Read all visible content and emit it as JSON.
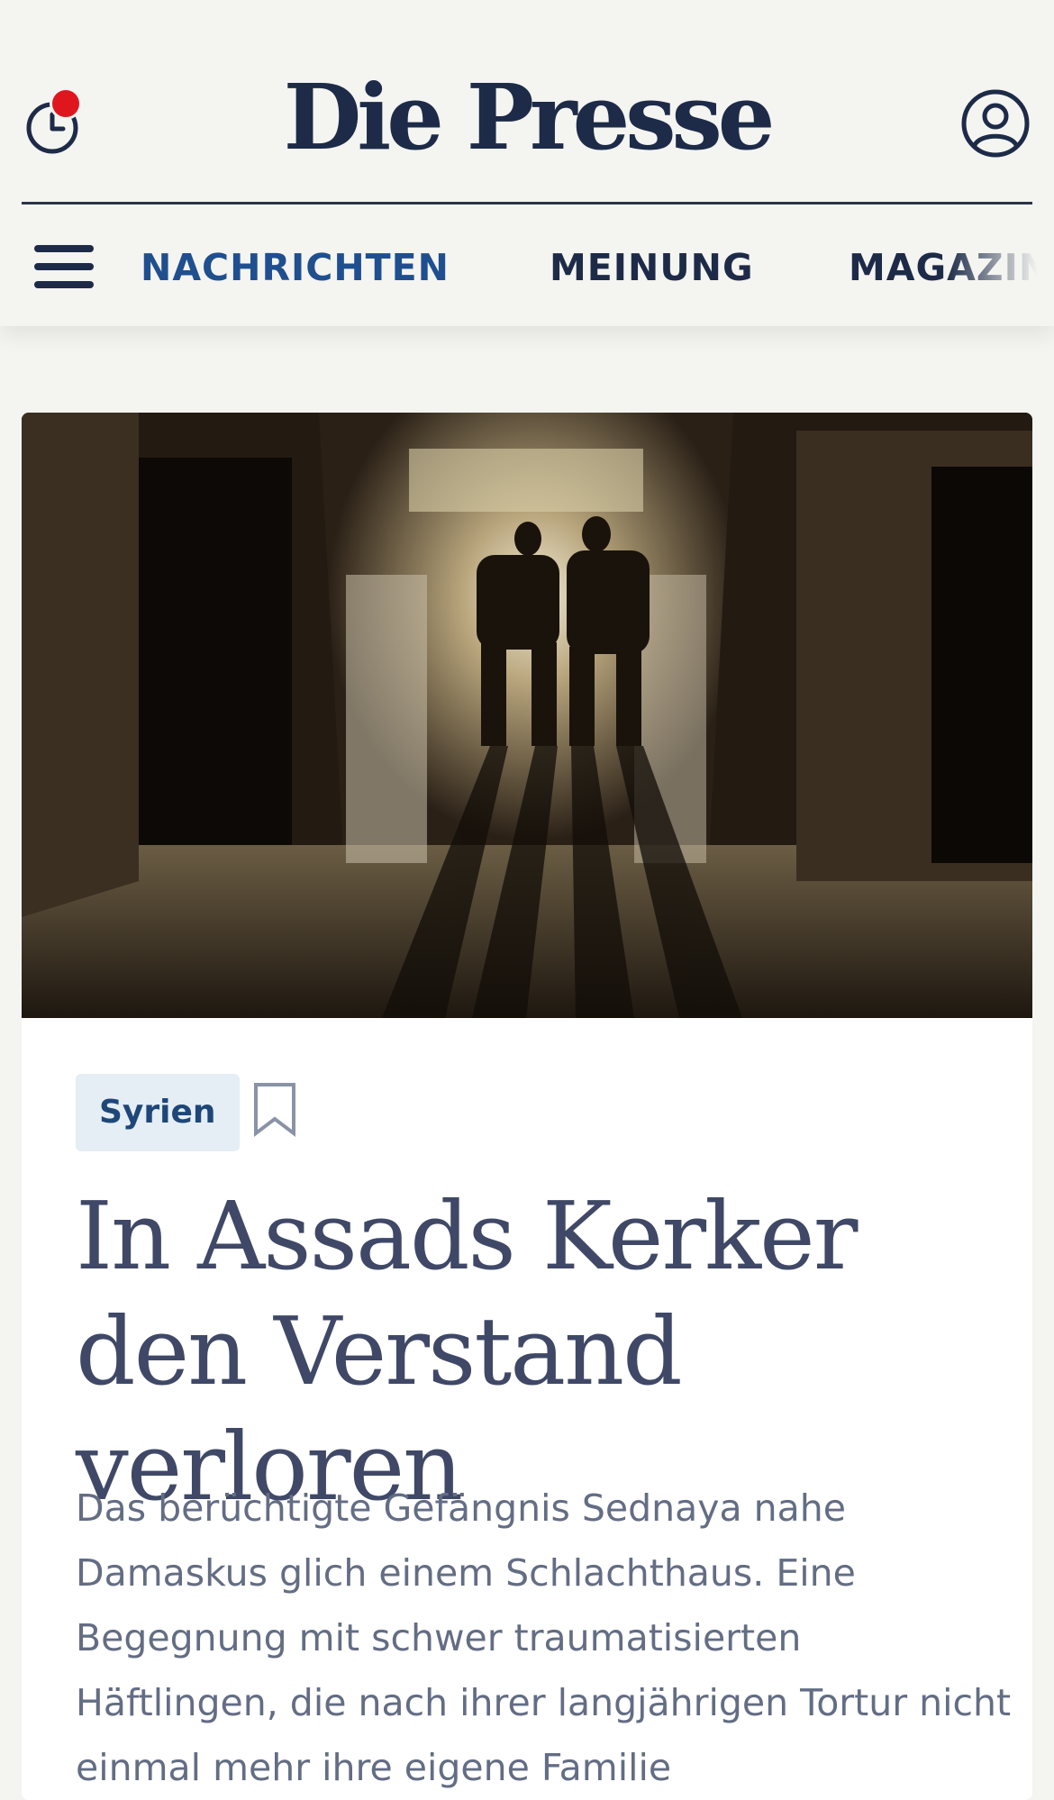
{
  "header": {
    "logo": "Die Presse",
    "history_icon": "clock-icon",
    "notification_dot_color": "#e0161f",
    "account_icon": "user-circle-icon",
    "menu_icon": "hamburger-menu-icon"
  },
  "nav": {
    "tabs": [
      {
        "label": "NACHRICHTEN",
        "active": true
      },
      {
        "label": "MEINUNG",
        "active": false
      },
      {
        "label": "MAGAZIN",
        "active": false
      }
    ]
  },
  "article": {
    "tag": "Syrien",
    "bookmark_icon": "bookmark-icon",
    "headline": "In Assads Kerker den Verstand verloren",
    "lead": "Das berüchtigte Gefängnis Sednaya nahe Damaskus glich einem Schlachthaus. Eine Begegnung mit schwer traumatisierten Häftlingen, die nach ihrer langjährigen Tortur nicht einmal mehr ihre eigene Familie"
  },
  "colors": {
    "brand_navy": "#1d2b48",
    "active_tab": "#1f4f8f",
    "tag_bg": "#e5edf5",
    "headline": "#3f4866",
    "lead_text": "#636d84",
    "page_bg": "#f4f4f1"
  }
}
